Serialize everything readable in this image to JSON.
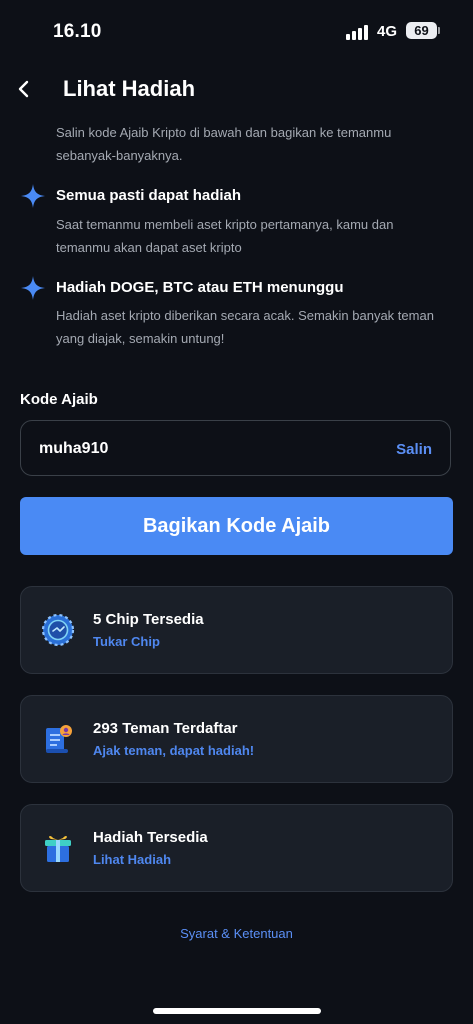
{
  "status_bar": {
    "time": "16.10",
    "network": "4G",
    "battery": "69"
  },
  "header": {
    "title": "Lihat Hadiah"
  },
  "intro": "Salin kode Ajaib Kripto di bawah dan bagikan ke temanmu sebanyak-banyaknya.",
  "features": [
    {
      "title": "Semua pasti dapat hadiah",
      "description": "Saat temanmu membeli aset kripto pertamanya, kamu dan temanmu akan dapat aset kripto",
      "icon": "sparkle-icon"
    },
    {
      "title": "Hadiah DOGE, BTC atau ETH menunggu",
      "description": "Hadiah aset kripto diberikan secara acak. Semakin banyak teman yang diajak, semakin untung!",
      "icon": "sparkle-icon"
    }
  ],
  "code": {
    "label": "Kode Ajaib",
    "value": "muha910",
    "copy_label": "Salin"
  },
  "share_button": "Bagikan Kode Ajaib",
  "cards": [
    {
      "title": "5 Chip Tersedia",
      "link": "Tukar Chip",
      "icon": "chip-icon"
    },
    {
      "title": "293 Teman Terdaftar",
      "link": "Ajak teman, dapat hadiah!",
      "icon": "friend-list-icon"
    },
    {
      "title": "Hadiah Tersedia",
      "link": "Lihat Hadiah",
      "icon": "gift-box-icon"
    }
  ],
  "terms": "Syarat & Ketentuan",
  "colors": {
    "accent": "#4a8af4",
    "link": "#5b8ff5",
    "background": "#0d1017",
    "card": "#1a1f28"
  }
}
